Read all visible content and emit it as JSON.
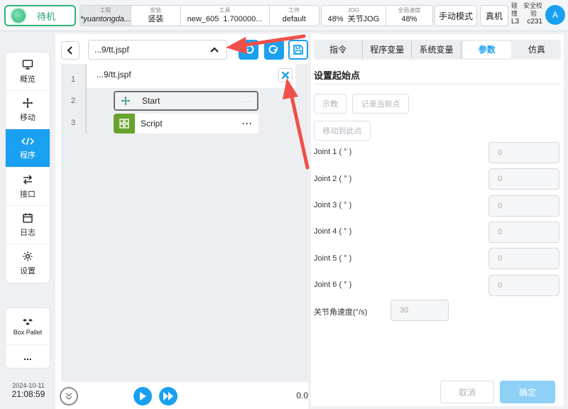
{
  "topbar": {
    "status": "待机",
    "project": {
      "label": "工程",
      "value": "*yuantongda..."
    },
    "install": {
      "label": "安装",
      "value": "竖装"
    },
    "tool": {
      "label": "工具",
      "name": "new_605",
      "value": "1.700000..."
    },
    "workpiece": {
      "label": "工件",
      "value": "default"
    },
    "jog": {
      "label": "JOG",
      "percent": "48%",
      "mode": "关节JOG"
    },
    "global_speed": {
      "label": "全局速度",
      "value": "48%"
    },
    "manual_mode": "手动模式",
    "real_machine": "真机",
    "collision": {
      "line1": "碰",
      "line2": "撞",
      "level": "L3"
    },
    "safety_check": {
      "line1": "安全校",
      "line2": "验",
      "code": "c231"
    },
    "avatar": "A"
  },
  "nav": {
    "items": [
      {
        "label": "概览",
        "icon": "monitor-icon"
      },
      {
        "label": "移动",
        "icon": "move-icon"
      },
      {
        "label": "程序",
        "icon": "code-icon",
        "active": true
      },
      {
        "label": "接口",
        "icon": "swap-icon"
      },
      {
        "label": "日志",
        "icon": "calendar-icon"
      },
      {
        "label": "设置",
        "icon": "gear-icon"
      }
    ],
    "box_pallet": "Box Pallet",
    "more": "...",
    "date": "2024-10-11",
    "time": "21:08:59"
  },
  "program": {
    "file": "...9/tt.jspf",
    "popup_file": "...9/tt.jspf",
    "lines": [
      "1",
      "2",
      "3"
    ],
    "nodes": [
      {
        "label": "Start",
        "dots": "···"
      },
      {
        "label": "Script",
        "dots": "···"
      }
    ],
    "speed_value": "0.0"
  },
  "rpanel": {
    "tabs": [
      "指令",
      "程序变量",
      "系统变量",
      "参数",
      "仿真"
    ],
    "active_tab": "参数",
    "title": "设置起始点",
    "teach": "示教",
    "record": "记录当前点",
    "move_to": "移动到此点",
    "joints": [
      {
        "label": "Joint 1 ( ° )",
        "value": "0"
      },
      {
        "label": "Joint 2 ( ° )",
        "value": "0"
      },
      {
        "label": "Joint 3 ( ° )",
        "value": "0"
      },
      {
        "label": "Joint 4 ( ° )",
        "value": "0"
      },
      {
        "label": "Joint 5 ( ° )",
        "value": "0"
      },
      {
        "label": "Joint 6 ( ° )",
        "value": "0"
      }
    ],
    "joint_speed_label": "关节角速度(°/s)",
    "joint_speed_value": "30",
    "cancel": "取消",
    "confirm": "确定"
  },
  "colors": {
    "accent": "#1aa0f0",
    "status_green": "#2fb37a",
    "script_green": "#6aa22f",
    "arrow_red": "#f0504a"
  }
}
